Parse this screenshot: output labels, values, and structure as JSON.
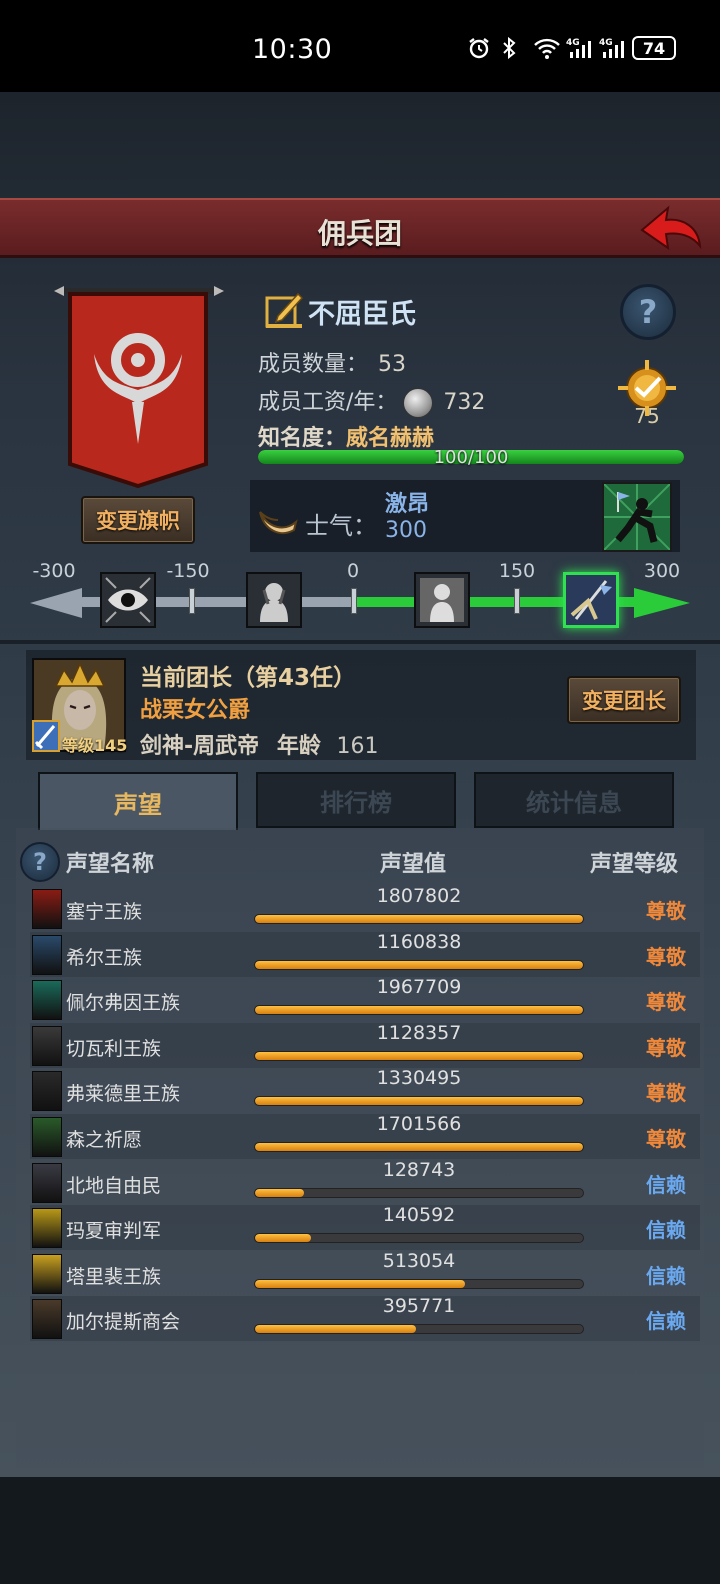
{
  "status": {
    "time": "10:30",
    "battery": "74",
    "net1": "4G",
    "net2": "4G"
  },
  "title": "佣兵团",
  "guild": {
    "name": "不屈臣氏",
    "members_label": "成员数量：",
    "members": "53",
    "wage_label": "成员工资/年：",
    "wage": "732",
    "fame_label": "知名度：",
    "fame_value": "威名赫赫",
    "fame_progress": "100/100",
    "fame_fraction": 1.0,
    "rank": "75",
    "change_flag": "变更旗帜"
  },
  "morale": {
    "label": "士气：",
    "word": "激昂",
    "value": "300"
  },
  "scale": {
    "labels": [
      "-300",
      "-150",
      "0",
      "150",
      "300"
    ]
  },
  "leader": {
    "title": "当前团长（第43任）",
    "name": "战栗女公爵",
    "profession": "剑神-周武帝",
    "age_label": "年龄",
    "age": "161",
    "level": "等级145",
    "change_button": "变更团长"
  },
  "tabs": [
    "声望",
    "排行榜",
    "统计信息"
  ],
  "table": {
    "headers": [
      "声望名称",
      "声望值",
      "声望等级"
    ],
    "rows": [
      {
        "name": "塞宁王族",
        "value": "1807802",
        "level": "尊敬",
        "fill": 1.0
      },
      {
        "name": "希尔王族",
        "value": "1160838",
        "level": "尊敬",
        "fill": 1.0
      },
      {
        "name": "佩尔弗因王族",
        "value": "1967709",
        "level": "尊敬",
        "fill": 1.0
      },
      {
        "name": "切瓦利王族",
        "value": "1128357",
        "level": "尊敬",
        "fill": 1.0
      },
      {
        "name": "弗莱德里王族",
        "value": "1330495",
        "level": "尊敬",
        "fill": 1.0
      },
      {
        "name": "森之祈愿",
        "value": "1701566",
        "level": "尊敬",
        "fill": 1.0
      },
      {
        "name": "北地自由民",
        "value": "128743",
        "level": "信赖",
        "fill": 0.15
      },
      {
        "name": "玛夏审判军",
        "value": "140592",
        "level": "信赖",
        "fill": 0.17
      },
      {
        "name": "塔里裴王族",
        "value": "513054",
        "level": "信赖",
        "fill": 0.64
      },
      {
        "name": "加尔提斯商会",
        "value": "395771",
        "level": "信赖",
        "fill": 0.49
      }
    ]
  },
  "colors": {
    "respect": "#f0883a",
    "trust": "#6aa8f0",
    "accent": "#f0b060",
    "green": "#2acc3a"
  }
}
